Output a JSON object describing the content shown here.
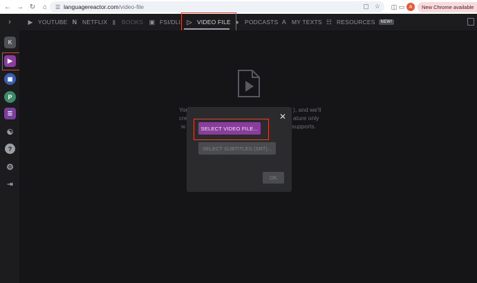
{
  "browser": {
    "url_host": "languagereactor.com",
    "url_path": "/video-file",
    "profile_initial": "A",
    "update_label": "New Chrome available"
  },
  "tabs": [
    {
      "label": "YOUTUBE",
      "icon": "youtube-icon"
    },
    {
      "label": "NETFLIX",
      "icon": "netflix-icon"
    },
    {
      "label": "BOOKS",
      "icon": "book-icon"
    },
    {
      "label": "FSI/DLI",
      "icon": "document-icon"
    },
    {
      "label": "VIDEO FILE",
      "icon": "video-file-icon"
    },
    {
      "label": "PODCASTS",
      "icon": "microphone-icon"
    },
    {
      "label": "MY TEXTS",
      "icon": "text-icon"
    },
    {
      "label": "RESOURCES",
      "icon": "resources-icon",
      "badge": "NEW!"
    }
  ],
  "sidebar": {
    "items": [
      {
        "label": "K",
        "icon": "k-icon",
        "color": "#5a5d61"
      },
      {
        "icon": "play-icon",
        "color": "#8a3d9c"
      },
      {
        "icon": "chat-icon",
        "color": "#3b5fb0"
      },
      {
        "label": "P",
        "icon": "p-icon",
        "color": "#3c8a6a"
      },
      {
        "icon": "list-icon",
        "color": "#7a3f9a"
      },
      {
        "icon": "running-figure-icon",
        "color": "#1c1c1e"
      },
      {
        "label": "?",
        "icon": "help-icon",
        "color": "#9aa0a6"
      },
      {
        "icon": "gear-icon",
        "color": "#9aa0a6"
      },
      {
        "icon": "logout-icon",
        "color": "#9aa0a6"
      }
    ]
  },
  "background_text": {
    "line1_left": "You",
    "line1_right": "), and we'll",
    "line2_left": "cre",
    "line2_right": "ature only",
    "line3_left": "w",
    "line3_right": "supports."
  },
  "modal": {
    "select_video_label": "SELECT VIDEO FILE...",
    "select_subtitles_label": "SELECT SUBTITLES (SRT)...",
    "ok_label": "OK"
  }
}
